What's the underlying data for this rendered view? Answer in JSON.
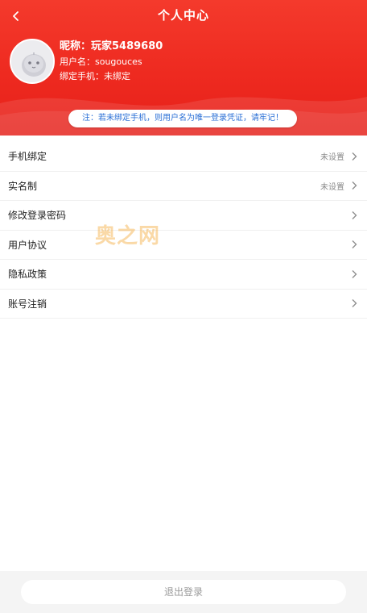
{
  "header": {
    "title": "个人中心",
    "back_icon": "chevron-left-icon"
  },
  "profile": {
    "nickname": "昵称：玩家5489680",
    "username": "用户名：sougouces",
    "phone": "绑定手机：未绑定"
  },
  "notice": "注：若未绑定手机，则用户名为唯一登录凭证，请牢记！",
  "menu": {
    "items": [
      {
        "label": "手机绑定",
        "value": "未设置"
      },
      {
        "label": "实名制",
        "value": "未设置"
      },
      {
        "label": "修改登录密码",
        "value": ""
      },
      {
        "label": "用户协议",
        "value": ""
      },
      {
        "label": "隐私政策",
        "value": ""
      },
      {
        "label": "账号注销",
        "value": ""
      }
    ]
  },
  "watermark": "奥之网",
  "footer": {
    "logout_label": "退出登录"
  },
  "colors": {
    "header_red": "#ee2a20",
    "notice_blue": "#2a6fd6",
    "watermark": "#f5aa3c"
  }
}
